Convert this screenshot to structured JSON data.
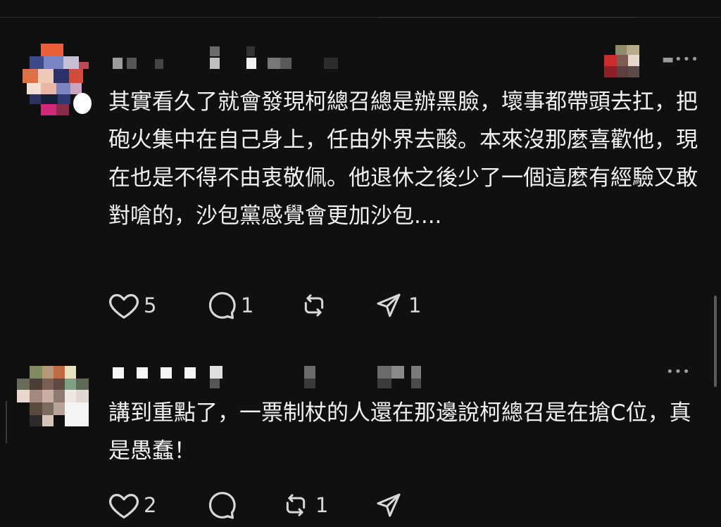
{
  "posts": [
    {
      "text": "其實看久了就會發現柯總召總是辦黑臉，壞事都帶頭去扛，把砲火集中在自己身上，任由外界去酸。本來沒那麼喜歡他，現在也是不得不由衷敬佩。他退休之後少了一個這麼有經驗又敢對嗆的，沙包黨感覺會更加沙包....",
      "more_label": "▬•••",
      "likes": "5",
      "replies": "1",
      "reposts": "",
      "shares": "1"
    },
    {
      "text": "講到重點了，一票制杖的人還在那邊說柯總召是在搶C位，真是愚蠢！",
      "more_label": "•••",
      "likes": "2",
      "replies": "",
      "reposts": "1",
      "shares": ""
    }
  ],
  "icons": {
    "like": "heart-icon",
    "reply": "comment-icon",
    "repost": "repost-icon",
    "share": "send-icon",
    "more": "more-icon"
  },
  "colors": {
    "background": "#101010",
    "text": "#f2f2f2",
    "icon": "#d8d8d8",
    "muted": "#9a9a9a"
  }
}
